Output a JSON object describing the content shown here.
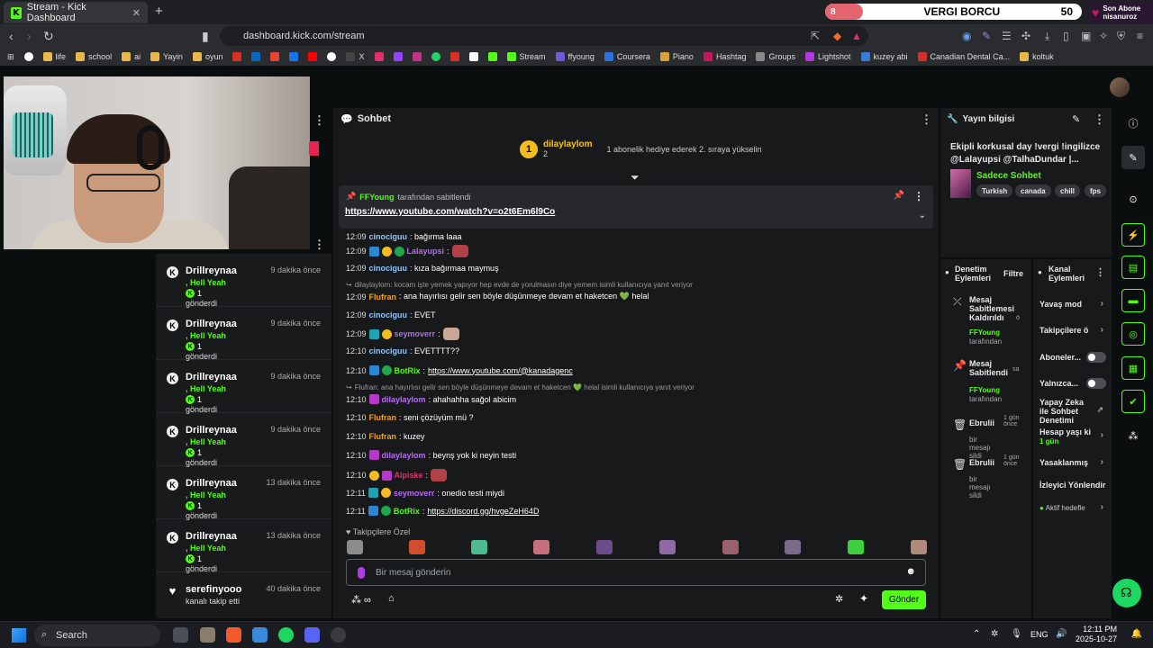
{
  "browser": {
    "tab_title": "Stream - Kick Dashboard",
    "url": "dashboard.kick.com/stream",
    "bookmarks": [
      "life",
      "school",
      "ai",
      "Yayin",
      "oyun",
      "X",
      "Stream",
      "ffyoung",
      "Coursera",
      "Piano",
      "Hashtag",
      "Groups",
      "Lightshot",
      "kuzey abi",
      "Canadian Dental Ca...",
      "koltuk"
    ]
  },
  "overlay": {
    "sub_goal_pill": "8",
    "sub_goal_title": "VERGI BORCU",
    "sub_goal_target": "50",
    "last_sub_label": "Son Abone",
    "last_sub_name": "nisanuroz"
  },
  "events": [
    {
      "name": "Drillreynaa",
      "time": "9 dakika önce",
      "message": ", Hell Yeah",
      "count": "1",
      "sent": "gönderdi"
    },
    {
      "name": "Drillreynaa",
      "time": "9 dakika önce",
      "message": ", Hell Yeah",
      "count": "1",
      "sent": "gönderdi"
    },
    {
      "name": "Drillreynaa",
      "time": "9 dakika önce",
      "message": ", Hell Yeah",
      "count": "1",
      "sent": "gönderdi"
    },
    {
      "name": "Drillreynaa",
      "time": "9 dakika önce",
      "message": ", Hell Yeah",
      "count": "1",
      "sent": "gönderdi"
    },
    {
      "name": "Drillreynaa",
      "time": "13 dakika önce",
      "message": ", Hell Yeah",
      "count": "1",
      "sent": "gönderdi"
    },
    {
      "name": "Drillreynaa",
      "time": "13 dakika önce",
      "message": ", Hell Yeah",
      "count": "1",
      "sent": "gönderdi"
    },
    {
      "name": "serefinyooo",
      "time": "40 dakika önce",
      "message": "kanalı takip etti",
      "count": "",
      "sent": ""
    }
  ],
  "chat": {
    "header": "Sohbet",
    "gifted_user": "dilaylaylom",
    "gifted_count": "2",
    "gifted_info": "1 abonelik hediye ederek 2. sıraya yükselin",
    "pinned_by": "FFYoung",
    "pinned_suffix": "tarafından sabitlendi",
    "pinned_link": "https://www.youtube.com/watch?v=o2t6Em6l9Co",
    "messages": [
      {
        "time": "12:09",
        "user": "cinociguu",
        "color": "#8ec5ff",
        "text": ": bağırma laaa",
        "reply": ""
      },
      {
        "time": "12:09",
        "user": "Lalayupsi",
        "color": "#b56cf0",
        "text": ":",
        "reply": ""
      },
      {
        "time": "12:09",
        "user": "cinociguu",
        "color": "#8ec5ff",
        "text": ": kıza bağırmaa maymuş",
        "reply": ""
      },
      {
        "time": "",
        "user": "",
        "color": "#999",
        "text": "",
        "reply": "dilaylaylom: kocam işte yemek yapıyor hep evde de yorulmasın diye yemem isimli kullanıcıya yanıt veriyor"
      },
      {
        "time": "12:09",
        "user": "Flufran",
        "color": "#f0a020",
        "text": ": ana hayırlısı gelir sen böyle düşünmeye devam et haketcen 💚 helal",
        "reply": ""
      },
      {
        "time": "12:09",
        "user": "cinociguu",
        "color": "#8ec5ff",
        "text": ": EVET",
        "reply": ""
      },
      {
        "time": "12:09",
        "user": "seymoverr",
        "color": "#b56cf0",
        "text": ":",
        "reply": ""
      },
      {
        "time": "12:10",
        "user": "cinociguu",
        "color": "#8ec5ff",
        "text": ": EVETTTT??",
        "reply": ""
      },
      {
        "time": "12:10",
        "user": "BotRix",
        "color": "#53fc18",
        "text": ": ",
        "link": "https://www.youtube.com/@kanadagenc",
        "reply": ""
      },
      {
        "time": "",
        "user": "",
        "color": "#999",
        "text": "",
        "reply": "Flufran: ana hayırlısı gelir sen böyle düşünmeye devam et haketcen 💚 helal isimli kullanıcıya yanıt veriyor"
      },
      {
        "time": "12:10",
        "user": "dilaylaylom",
        "color": "#b56cf0",
        "text": ": ahahahha sağol abicim",
        "reply": ""
      },
      {
        "time": "12:10",
        "user": "Flufran",
        "color": "#f0a020",
        "text": ": seni çözüyüm mü ?",
        "reply": ""
      },
      {
        "time": "12:10",
        "user": "Flufran",
        "color": "#f0a020",
        "text": ": kuzey",
        "reply": ""
      },
      {
        "time": "12:10",
        "user": "dilaylaylom",
        "color": "#b56cf0",
        "text": ": beynş yok ki neyin testi",
        "reply": ""
      },
      {
        "time": "12:10",
        "user": "Alpiske",
        "color": "#e0306a",
        "text": ":",
        "reply": ""
      },
      {
        "time": "12:11",
        "user": "seymoverr",
        "color": "#b56cf0",
        "text": ": onedio testi miydi",
        "reply": ""
      },
      {
        "time": "12:11",
        "user": "BotRix",
        "color": "#53fc18",
        "text": ": ",
        "link": "https://discord.gg/hvgeZeH64D",
        "reply": ""
      }
    ],
    "followers_only_label": "Takipçilere Özel",
    "input_placeholder": "Bir mesaj gönderin",
    "send_label": "Gönder"
  },
  "stream_info": {
    "header": "Yayın bilgisi",
    "title": "Ekipli korkusal day !vergi !ingilizce @Lalayupsi @TalhaDundar |...",
    "category": "Sadece Sohbet",
    "tags": [
      "Turkish",
      "canada",
      "chill",
      "fps"
    ]
  },
  "mod_actions": {
    "header": "Denetim Eylemleri",
    "filter": "Filtre",
    "items": [
      {
        "action": "Mesaj Sabitlemesi Kaldırıldı",
        "by": "FFYoung",
        "by_suffix": "tarafından",
        "time": "ö"
      },
      {
        "action": "Mesaj Sabitlendi",
        "by": "FFYoung",
        "by_suffix": "tarafından",
        "time": "sa"
      },
      {
        "action": "Ebrulii",
        "by": "",
        "by_suffix": "bir mesajı sildi",
        "time": "1 gün önce"
      },
      {
        "action": "Ebrulii",
        "by": "",
        "by_suffix": "bir mesajı sildi",
        "time": "1 gün önce"
      }
    ]
  },
  "channel_actions": {
    "header": "Kanal Eylemleri",
    "items": [
      {
        "label": "Yavaş mod",
        "kind": "chevron"
      },
      {
        "label": "Takipçilere ö",
        "kind": "chevron"
      },
      {
        "label": "Aboneler...",
        "kind": "toggle"
      },
      {
        "label": "Yalnızca...",
        "kind": "toggle"
      },
      {
        "label": "Yapay Zeka ile Sohbet Denetimi",
        "kind": "external"
      },
      {
        "label": "Hesap yaşı ki",
        "kind": "chevron",
        "sub": "1 gün"
      },
      {
        "label": "Yasaklanmış",
        "kind": "chevron"
      },
      {
        "label": "İzleyici Yönlendir",
        "kind": "none"
      },
      {
        "label": "Aktif hedefle",
        "kind": "chevron"
      }
    ]
  },
  "taskbar": {
    "search": "Search",
    "lang": "ENG",
    "time": "12:11 PM",
    "date": "2025-10-27"
  }
}
